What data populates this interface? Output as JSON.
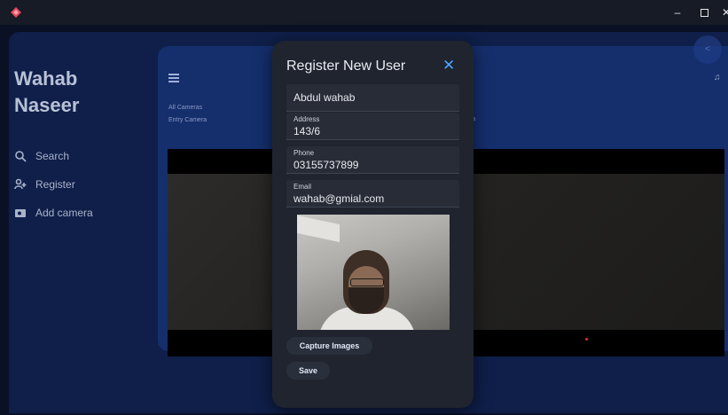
{
  "window": {
    "controls": {
      "minimize": "–",
      "close": "✕"
    }
  },
  "sidebar": {
    "user_name": "Wahab Naseer",
    "items": [
      {
        "label": "Search",
        "icon": "search-icon"
      },
      {
        "label": "Register",
        "icon": "user-add-icon"
      },
      {
        "label": "Add camera",
        "icon": "camera-icon"
      }
    ]
  },
  "main": {
    "cameras": [
      "All Cameras",
      "Entry Camera"
    ],
    "partial_label": "ra"
  },
  "back_button": {
    "label": "<"
  },
  "modal": {
    "title": "Register New User",
    "close_label": "✕",
    "fields": {
      "name": {
        "value": "Abdul wahab"
      },
      "address": {
        "label": "Address",
        "value": "143/6"
      },
      "phone": {
        "label": "Phone",
        "value": "03155737899"
      },
      "email": {
        "label": "Email",
        "value": "wahab@gmial.com"
      }
    },
    "capture_label": "Capture Images",
    "save_label": "Save"
  },
  "colors": {
    "background": "#0f1f4a",
    "modal": "#1f242e",
    "accent": "#4ea3ff",
    "logo": "#e8455a"
  }
}
